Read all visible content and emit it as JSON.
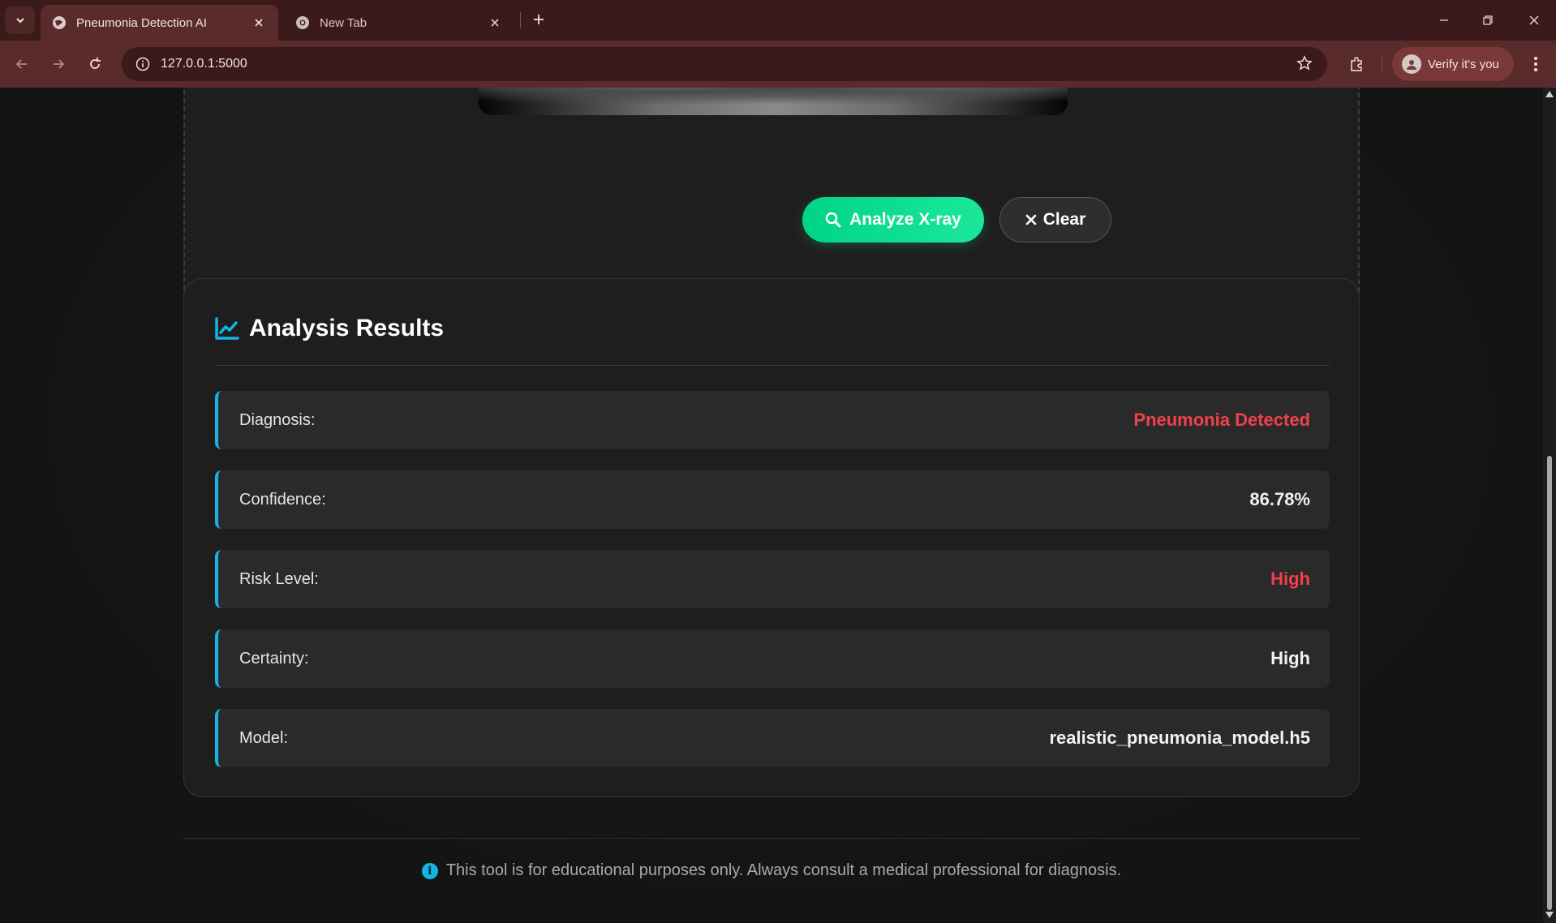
{
  "browser": {
    "tabs": [
      {
        "title": "Pneumonia Detection AI",
        "active": true
      },
      {
        "title": "New Tab",
        "active": false
      }
    ],
    "url": "127.0.0.1:5000",
    "profile_label": "Verify it's you"
  },
  "upload": {
    "analyze_label": "Analyze X-ray",
    "clear_label": "Clear"
  },
  "results": {
    "title": "Analysis Results",
    "rows": [
      {
        "label": "Diagnosis:",
        "value": "Pneumonia Detected",
        "tone": "danger"
      },
      {
        "label": "Confidence:",
        "value": "86.78%",
        "tone": "normal"
      },
      {
        "label": "Risk Level:",
        "value": "High",
        "tone": "danger"
      },
      {
        "label": "Certainty:",
        "value": "High",
        "tone": "normal"
      },
      {
        "label": "Model:",
        "value": "realistic_pneumonia_model.h5",
        "tone": "normal"
      }
    ]
  },
  "footer": {
    "disclaimer": "This tool is for educational purposes only. Always consult a medical professional for diagnosis."
  },
  "colors": {
    "accent": "#12b5e6",
    "primary_button": "#00d488",
    "danger": "#f0404c",
    "browser_frame": "#5a2b2b"
  }
}
